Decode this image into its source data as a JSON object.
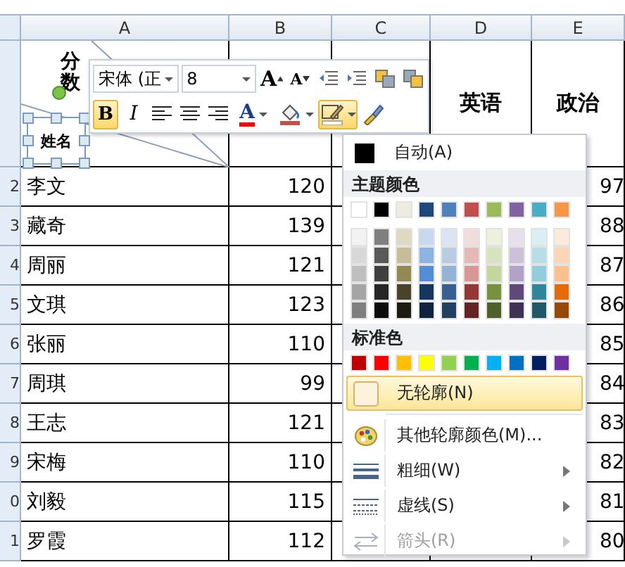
{
  "sheet": {
    "columns": [
      "A",
      "B",
      "C",
      "D",
      "E"
    ],
    "header_row": {
      "score_label": "分数",
      "name_label": "姓名",
      "column_d": "英语",
      "column_e": "政治"
    },
    "rows": [
      {
        "row_number": "2",
        "name": "李文",
        "column_b": "120",
        "column_e": "97"
      },
      {
        "row_number": "3",
        "name": "藏奇",
        "column_b": "139",
        "column_e": "88"
      },
      {
        "row_number": "4",
        "name": "周丽",
        "column_b": "121",
        "column_e": "87"
      },
      {
        "row_number": "5",
        "name": "文琪",
        "column_b": "123",
        "column_e": "86"
      },
      {
        "row_number": "6",
        "name": "张丽",
        "column_b": "110",
        "column_e": "85"
      },
      {
        "row_number": "7",
        "name": "周琪",
        "column_b": "99",
        "column_e": "84"
      },
      {
        "row_number": "8",
        "name": "王志",
        "column_b": "121",
        "column_e": "83"
      },
      {
        "row_number": "9",
        "name": "宋梅",
        "column_b": "110",
        "column_e": "82"
      },
      {
        "row_number": "0",
        "name": "刘毅",
        "column_b": "115",
        "column_e": "81"
      },
      {
        "row_number": "1",
        "name": "罗霞",
        "column_b": "112",
        "column_e": "80"
      }
    ]
  },
  "mini_toolbar": {
    "font": "宋体 (正",
    "size": "8",
    "row1": [
      {
        "kind": "grow-font",
        "label": "A",
        "selected": false
      },
      {
        "kind": "shrink-font",
        "label": "A",
        "selected": false
      },
      {
        "kind": "decrease-indent",
        "selected": false
      },
      {
        "kind": "increase-indent",
        "selected": false
      },
      {
        "kind": "bring-forward",
        "selected": false
      },
      {
        "kind": "send-backward",
        "selected": false
      }
    ],
    "row2": [
      {
        "kind": "bold",
        "label": "B",
        "selected": true
      },
      {
        "kind": "italic",
        "label": "I",
        "selected": false
      },
      {
        "kind": "align-left",
        "selected": false
      },
      {
        "kind": "align-center",
        "selected": false
      },
      {
        "kind": "align-right",
        "selected": false
      },
      {
        "kind": "font-color",
        "label": "A",
        "selected": false
      },
      {
        "kind": "fill-color",
        "selected": false
      },
      {
        "kind": "outline-color",
        "selected": true
      },
      {
        "kind": "format-painter",
        "selected": false
      }
    ]
  },
  "outline_menu": {
    "automatic": {
      "label": "自动(A)",
      "color": "#000000"
    },
    "theme_header": "主题颜色",
    "theme_colors": [
      {
        "color": "#ffffff",
        "shades": [
          {
            "color": "#f2f2f2"
          },
          {
            "color": "#d8d8d8"
          },
          {
            "color": "#bfbfbf"
          },
          {
            "color": "#a5a5a5"
          },
          {
            "color": "#7f7f7f"
          }
        ]
      },
      {
        "color": "#000000",
        "shades": [
          {
            "color": "#7f7f7f"
          },
          {
            "color": "#595959"
          },
          {
            "color": "#3f3f3f"
          },
          {
            "color": "#262626"
          },
          {
            "color": "#0c0c0c"
          }
        ]
      },
      {
        "color": "#eeece1",
        "shades": [
          {
            "color": "#ddd9c3"
          },
          {
            "color": "#c4bd97"
          },
          {
            "color": "#938953"
          },
          {
            "color": "#494429"
          },
          {
            "color": "#1d1b10"
          }
        ]
      },
      {
        "color": "#1f497d",
        "shades": [
          {
            "color": "#c6d9f0"
          },
          {
            "color": "#8db3e2"
          },
          {
            "color": "#548dd4"
          },
          {
            "color": "#17365d"
          },
          {
            "color": "#0f243e"
          }
        ]
      },
      {
        "color": "#4f81bd",
        "shades": [
          {
            "color": "#dbe5f1"
          },
          {
            "color": "#b8cce4"
          },
          {
            "color": "#95b3d7"
          },
          {
            "color": "#366092"
          },
          {
            "color": "#244061"
          }
        ]
      },
      {
        "color": "#c0504d",
        "shades": [
          {
            "color": "#f2dcdb"
          },
          {
            "color": "#e5b9b7"
          },
          {
            "color": "#d99694"
          },
          {
            "color": "#953734"
          },
          {
            "color": "#632423"
          }
        ]
      },
      {
        "color": "#9bbb59",
        "shades": [
          {
            "color": "#ebf1dd"
          },
          {
            "color": "#d7e3bc"
          },
          {
            "color": "#c3d69b"
          },
          {
            "color": "#76923c"
          },
          {
            "color": "#4f6128"
          }
        ]
      },
      {
        "color": "#8064a2",
        "shades": [
          {
            "color": "#e5e0ec"
          },
          {
            "color": "#ccc1d9"
          },
          {
            "color": "#b2a2c7"
          },
          {
            "color": "#5f497a"
          },
          {
            "color": "#3f3151"
          }
        ]
      },
      {
        "color": "#4bacc6",
        "shades": [
          {
            "color": "#dbeef3"
          },
          {
            "color": "#b7dde8"
          },
          {
            "color": "#92cddc"
          },
          {
            "color": "#31859b"
          },
          {
            "color": "#205867"
          }
        ]
      },
      {
        "color": "#f79646",
        "shades": [
          {
            "color": "#fdeada"
          },
          {
            "color": "#fbd5b5"
          },
          {
            "color": "#fac08f"
          },
          {
            "color": "#e36c09"
          },
          {
            "color": "#974806"
          }
        ]
      }
    ],
    "standard_header": "标准色",
    "standard_colors": [
      {
        "color": "#c00000"
      },
      {
        "color": "#ff0000"
      },
      {
        "color": "#ffc000"
      },
      {
        "color": "#ffff00"
      },
      {
        "color": "#92d050"
      },
      {
        "color": "#00b050"
      },
      {
        "color": "#00b0f0"
      },
      {
        "color": "#0070c0"
      },
      {
        "color": "#002060"
      },
      {
        "color": "#7030a0"
      }
    ],
    "items": [
      {
        "kind": "no-outline",
        "label": "无轮廓(N)",
        "highlighted": true,
        "disabled": false,
        "submenu": false
      },
      {
        "kind": "more-colors",
        "label": "其他轮廓颜色(M)...",
        "highlighted": false,
        "disabled": false,
        "submenu": false
      },
      {
        "kind": "weight",
        "label": "粗细(W)",
        "highlighted": false,
        "disabled": false,
        "submenu": true
      },
      {
        "kind": "dashes",
        "label": "虚线(S)",
        "highlighted": false,
        "disabled": false,
        "submenu": true
      },
      {
        "kind": "arrows",
        "label": "箭头(R)",
        "highlighted": false,
        "disabled": true,
        "submenu": true
      }
    ]
  }
}
